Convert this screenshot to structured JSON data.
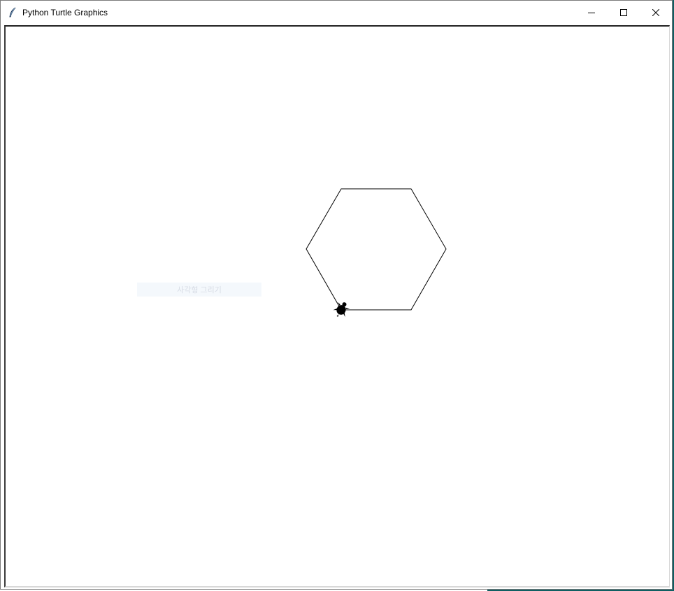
{
  "window": {
    "title": "Python Turtle Graphics",
    "icon": "feather-icon",
    "controls": [
      "minimize-icon",
      "maximize-icon",
      "close-icon"
    ]
  },
  "canvas": {
    "background": "#ffffff",
    "ghost_text": "사각형 그리기",
    "drawing": {
      "shape": "hexagon",
      "sides": 6,
      "side_length": 100,
      "pen_color": "#000000",
      "turtle_color": "#000000",
      "turtle_shape": "turtle"
    }
  },
  "colors": {
    "desktop": "#0f5f63",
    "title_bar": "#ffffff"
  }
}
